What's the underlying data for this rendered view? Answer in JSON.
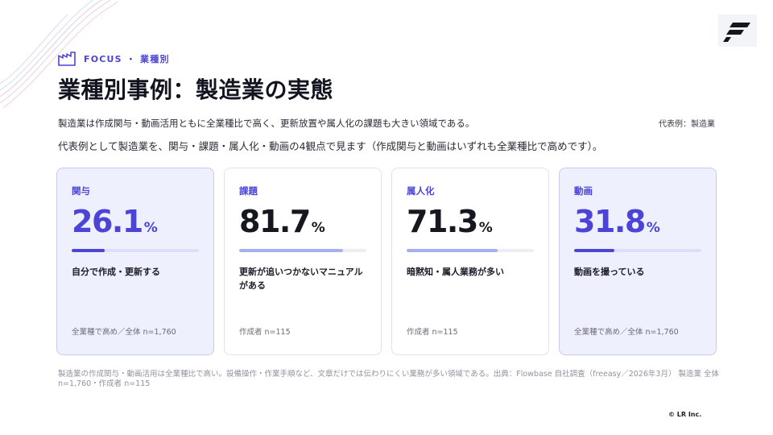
{
  "kicker": "FOCUS ・ 業種別",
  "title": "業種別事例：製造業の実態",
  "lead": "製造業は作成関与・動画活用ともに全業種比で高く、更新放置や属人化の課題も大きい領域である。",
  "sample_label": "代表例：製造業",
  "lead2": "代表例として製造業を、関与・課題・属人化・動画の4観点で見ます（作成関与と動画はいずれも全業種比で高めです）。",
  "colors": {
    "accent": "#4b44d6",
    "highlight_bg": "#eff0fd",
    "bar_light": "#a9aef0"
  },
  "cards": [
    {
      "label": "関与",
      "value": "26.1",
      "unit": "%",
      "progress": 0.261,
      "description": "自分で作成・更新する",
      "note": "全業種で高め／全体 n=1,760",
      "highlight": true
    },
    {
      "label": "課題",
      "value": "81.7",
      "unit": "%",
      "progress": 0.817,
      "description": "更新が追いつかないマニュアルがある",
      "note": "作成者 n=115",
      "highlight": false
    },
    {
      "label": "属人化",
      "value": "71.3",
      "unit": "%",
      "progress": 0.713,
      "description": "暗黙知・属人業務が多い",
      "note": "作成者 n=115",
      "highlight": false
    },
    {
      "label": "動画",
      "value": "31.8",
      "unit": "%",
      "progress": 0.318,
      "description": "動画を撮っている",
      "note": "全業種で高め／全体 n=1,760",
      "highlight": true
    }
  ],
  "footnote": "製造業の作成関与・動画活用は全業種比で高い。設備操作・作業手順など、文章だけでは伝わりにくい業務が多い領域である。出典：Flowbase 自社調査（freeasy／2026年3月） 製造業 全体 n=1,760・作成者 n=115",
  "copyright": "© LR Inc.",
  "icons": {
    "kicker": "factory-icon",
    "logo": "brand-logo-icon"
  }
}
